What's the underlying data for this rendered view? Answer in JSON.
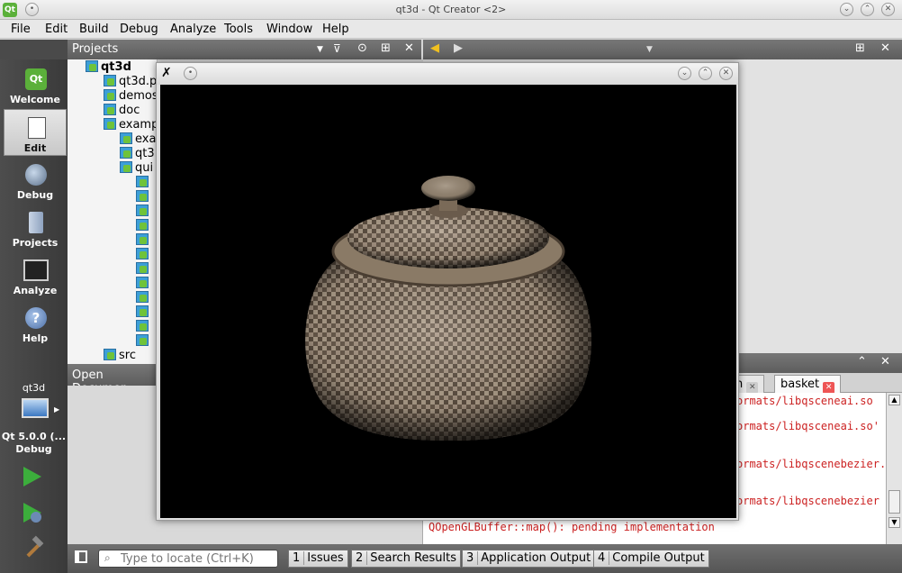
{
  "window": {
    "title": "qt3d - Qt Creator <2>"
  },
  "menu": [
    "File",
    "Edit",
    "Build",
    "Debug",
    "Analyze",
    "Tools",
    "Window",
    "Help"
  ],
  "modes": [
    {
      "label": "Welcome",
      "icon": "qt-logo-icon"
    },
    {
      "label": "Edit",
      "icon": "document-edit-icon"
    },
    {
      "label": "Debug",
      "icon": "bug-icon"
    },
    {
      "label": "Projects",
      "icon": "folder-icon"
    },
    {
      "label": "Analyze",
      "icon": "oscilloscope-icon"
    },
    {
      "label": "Help",
      "icon": "question-icon"
    }
  ],
  "kit": {
    "project": "qt3d",
    "name": "Qt 5.0.0 (...",
    "config": "Debug"
  },
  "projects_panel": {
    "title": "Projects",
    "tree": [
      {
        "text": "qt3d",
        "bold": true
      },
      {
        "text": "qt3d.p"
      },
      {
        "text": "demos"
      },
      {
        "text": "doc"
      },
      {
        "text": "examp"
      },
      {
        "text": "exa"
      },
      {
        "text": "qt3"
      },
      {
        "text": "qui"
      },
      {
        "text": ""
      },
      {
        "text": ""
      },
      {
        "text": ""
      },
      {
        "text": ""
      },
      {
        "text": ""
      },
      {
        "text": ""
      },
      {
        "text": ""
      },
      {
        "text": ""
      },
      {
        "text": ""
      },
      {
        "text": ""
      },
      {
        "text": ""
      },
      {
        "text": ""
      },
      {
        "text": "src"
      }
    ]
  },
  "open_documents": {
    "title": "Open Documer"
  },
  "output": {
    "tabs": [
      {
        "label": "n"
      },
      {
        "label": "basket"
      }
    ],
    "lines": [
      "ormats/libqsceneai.so",
      "ormats/libqsceneai.so'",
      "ormats/libqscenebezier.",
      "ormats/libqscenebezier",
      "QOpenGLBuffer::map(): pending implementation"
    ]
  },
  "locator": {
    "placeholder": "Type to locate (Ctrl+K)"
  },
  "status_tabs": [
    {
      "num": "1",
      "label": "Issues"
    },
    {
      "num": "2",
      "label": "Search Results"
    },
    {
      "num": "3",
      "label": "Application Output"
    },
    {
      "num": "4",
      "label": "Compile Output"
    }
  ],
  "colors": {
    "accent_green": "#3cae3c",
    "output_text": "#cc2222",
    "panel_header": "#666666"
  }
}
